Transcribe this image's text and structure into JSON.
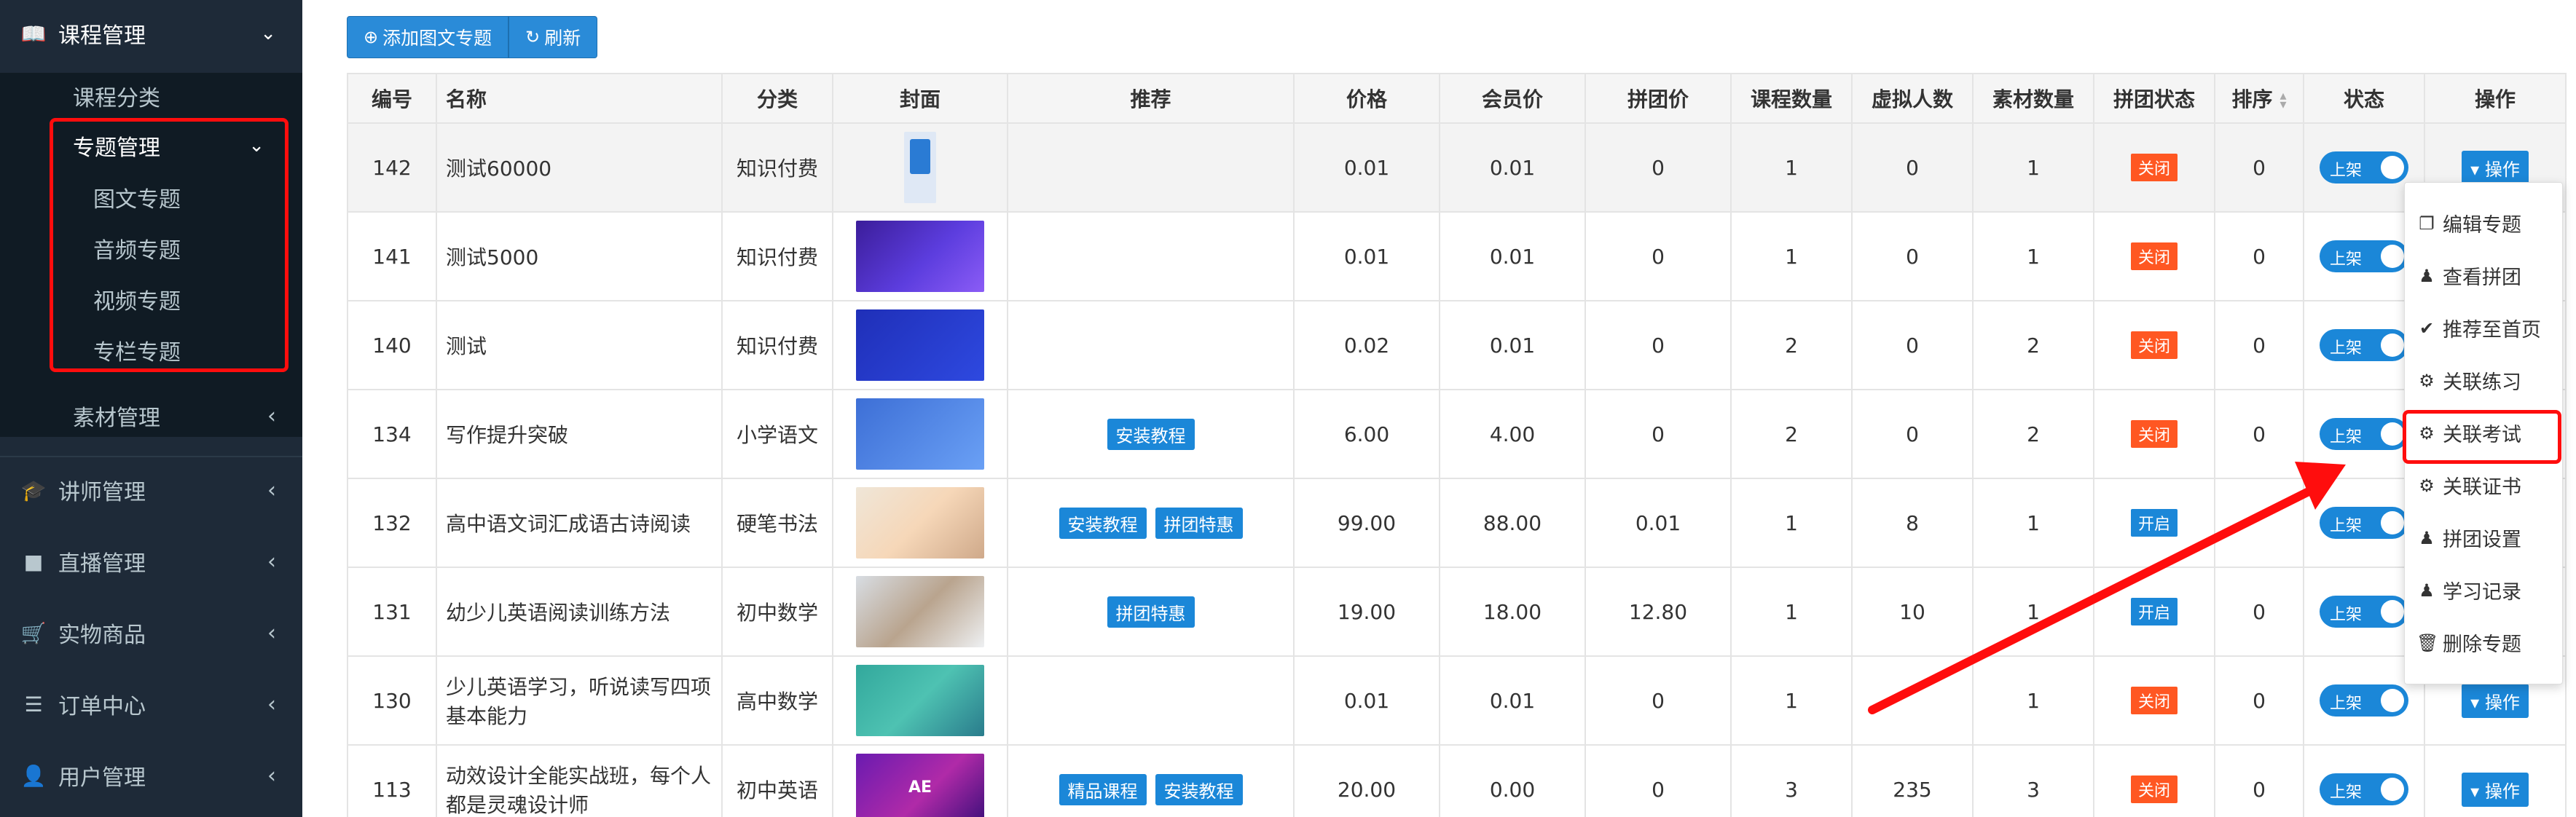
{
  "sidebar": {
    "course_mgmt": "课程管理",
    "course_category": "课程分类",
    "topic_mgmt": "专题管理",
    "topic_items": [
      "图文专题",
      "音频专题",
      "视频专题",
      "专栏专题"
    ],
    "material_mgmt": "素材管理",
    "lecturer_mgmt": "讲师管理",
    "live_mgmt": "直播管理",
    "goods": "实物商品",
    "orders": "订单中心",
    "users": "用户管理"
  },
  "toolbar": {
    "add_label": "添加图文专题",
    "refresh_label": "刷新"
  },
  "table": {
    "headers": [
      "编号",
      "名称",
      "分类",
      "封面",
      "推荐",
      "价格",
      "会员价",
      "拼团价",
      "课程数量",
      "虚拟人数",
      "素材数量",
      "拼团状态",
      "排序",
      "状态",
      "操作"
    ],
    "rows": [
      {
        "id": "142",
        "name": "测试60000",
        "category": "知识付费",
        "cover_text": "",
        "tags": [],
        "price": "0.01",
        "vip": "0.01",
        "group": "0",
        "courses": "1",
        "virtual": "0",
        "materials": "1",
        "gstatus": "关闭",
        "gon": false,
        "sort": "0",
        "status": "上架",
        "op": "操作"
      },
      {
        "id": "141",
        "name": "测试5000",
        "category": "知识付费",
        "cover_text": "",
        "tags": [],
        "price": "0.01",
        "vip": "0.01",
        "group": "0",
        "courses": "1",
        "virtual": "0",
        "materials": "1",
        "gstatus": "关闭",
        "gon": false,
        "sort": "0",
        "status": "上架",
        "op": "操作"
      },
      {
        "id": "140",
        "name": "测试",
        "category": "知识付费",
        "cover_text": "",
        "tags": [],
        "price": "0.02",
        "vip": "0.01",
        "group": "0",
        "courses": "2",
        "virtual": "0",
        "materials": "2",
        "gstatus": "关闭",
        "gon": false,
        "sort": "0",
        "status": "上架",
        "op": "操作"
      },
      {
        "id": "134",
        "name": "写作提升突破",
        "category": "小学语文",
        "cover_text": "",
        "tags": [
          "安装教程"
        ],
        "price": "6.00",
        "vip": "4.00",
        "group": "0",
        "courses": "2",
        "virtual": "0",
        "materials": "2",
        "gstatus": "关闭",
        "gon": false,
        "sort": "0",
        "status": "上架",
        "op": "操作"
      },
      {
        "id": "132",
        "name": "高中语文词汇成语古诗阅读",
        "category": "硬笔书法",
        "cover_text": "",
        "tags": [
          "安装教程",
          "拼团特惠"
        ],
        "price": "99.00",
        "vip": "88.00",
        "group": "0.01",
        "courses": "1",
        "virtual": "8",
        "materials": "1",
        "gstatus": "开启",
        "gon": true,
        "sort": "",
        "status": "上架",
        "op": ""
      },
      {
        "id": "131",
        "name": "幼少儿英语阅读训练方法",
        "category": "初中数学",
        "cover_text": "",
        "tags": [
          "拼团特惠"
        ],
        "price": "19.00",
        "vip": "18.00",
        "group": "12.80",
        "courses": "1",
        "virtual": "10",
        "materials": "1",
        "gstatus": "开启",
        "gon": true,
        "sort": "0",
        "status": "上架",
        "op": ""
      },
      {
        "id": "130",
        "name": "少儿英语学习，听说读写四项基本能力",
        "category": "高中数学",
        "cover_text": "",
        "tags": [],
        "price": "0.01",
        "vip": "0.01",
        "group": "0",
        "courses": "1",
        "virtual": "",
        "materials": "1",
        "gstatus": "关闭",
        "gon": false,
        "sort": "0",
        "status": "上架",
        "op": "操作"
      },
      {
        "id": "113",
        "name": "动效设计全能实战班，每个人都是灵魂设计师",
        "category": "初中英语",
        "cover_text": "AE",
        "tags": [
          "精品课程",
          "安装教程"
        ],
        "price": "20.00",
        "vip": "0.00",
        "group": "0",
        "courses": "3",
        "virtual": "235",
        "materials": "3",
        "gstatus": "关闭",
        "gon": false,
        "sort": "0",
        "status": "上架",
        "op": "操作"
      }
    ]
  },
  "dropdown": {
    "items": [
      "编辑专题",
      "查看拼团",
      "推荐至首页",
      "关联练习",
      "关联考试",
      "关联证书",
      "拼团设置",
      "学习记录",
      "删除专题"
    ]
  },
  "colors": {
    "sidebar_bg": "#1e2a38",
    "primary": "#1b87d8",
    "danger": "#ff5722",
    "highlight": "#ff0d0d"
  }
}
